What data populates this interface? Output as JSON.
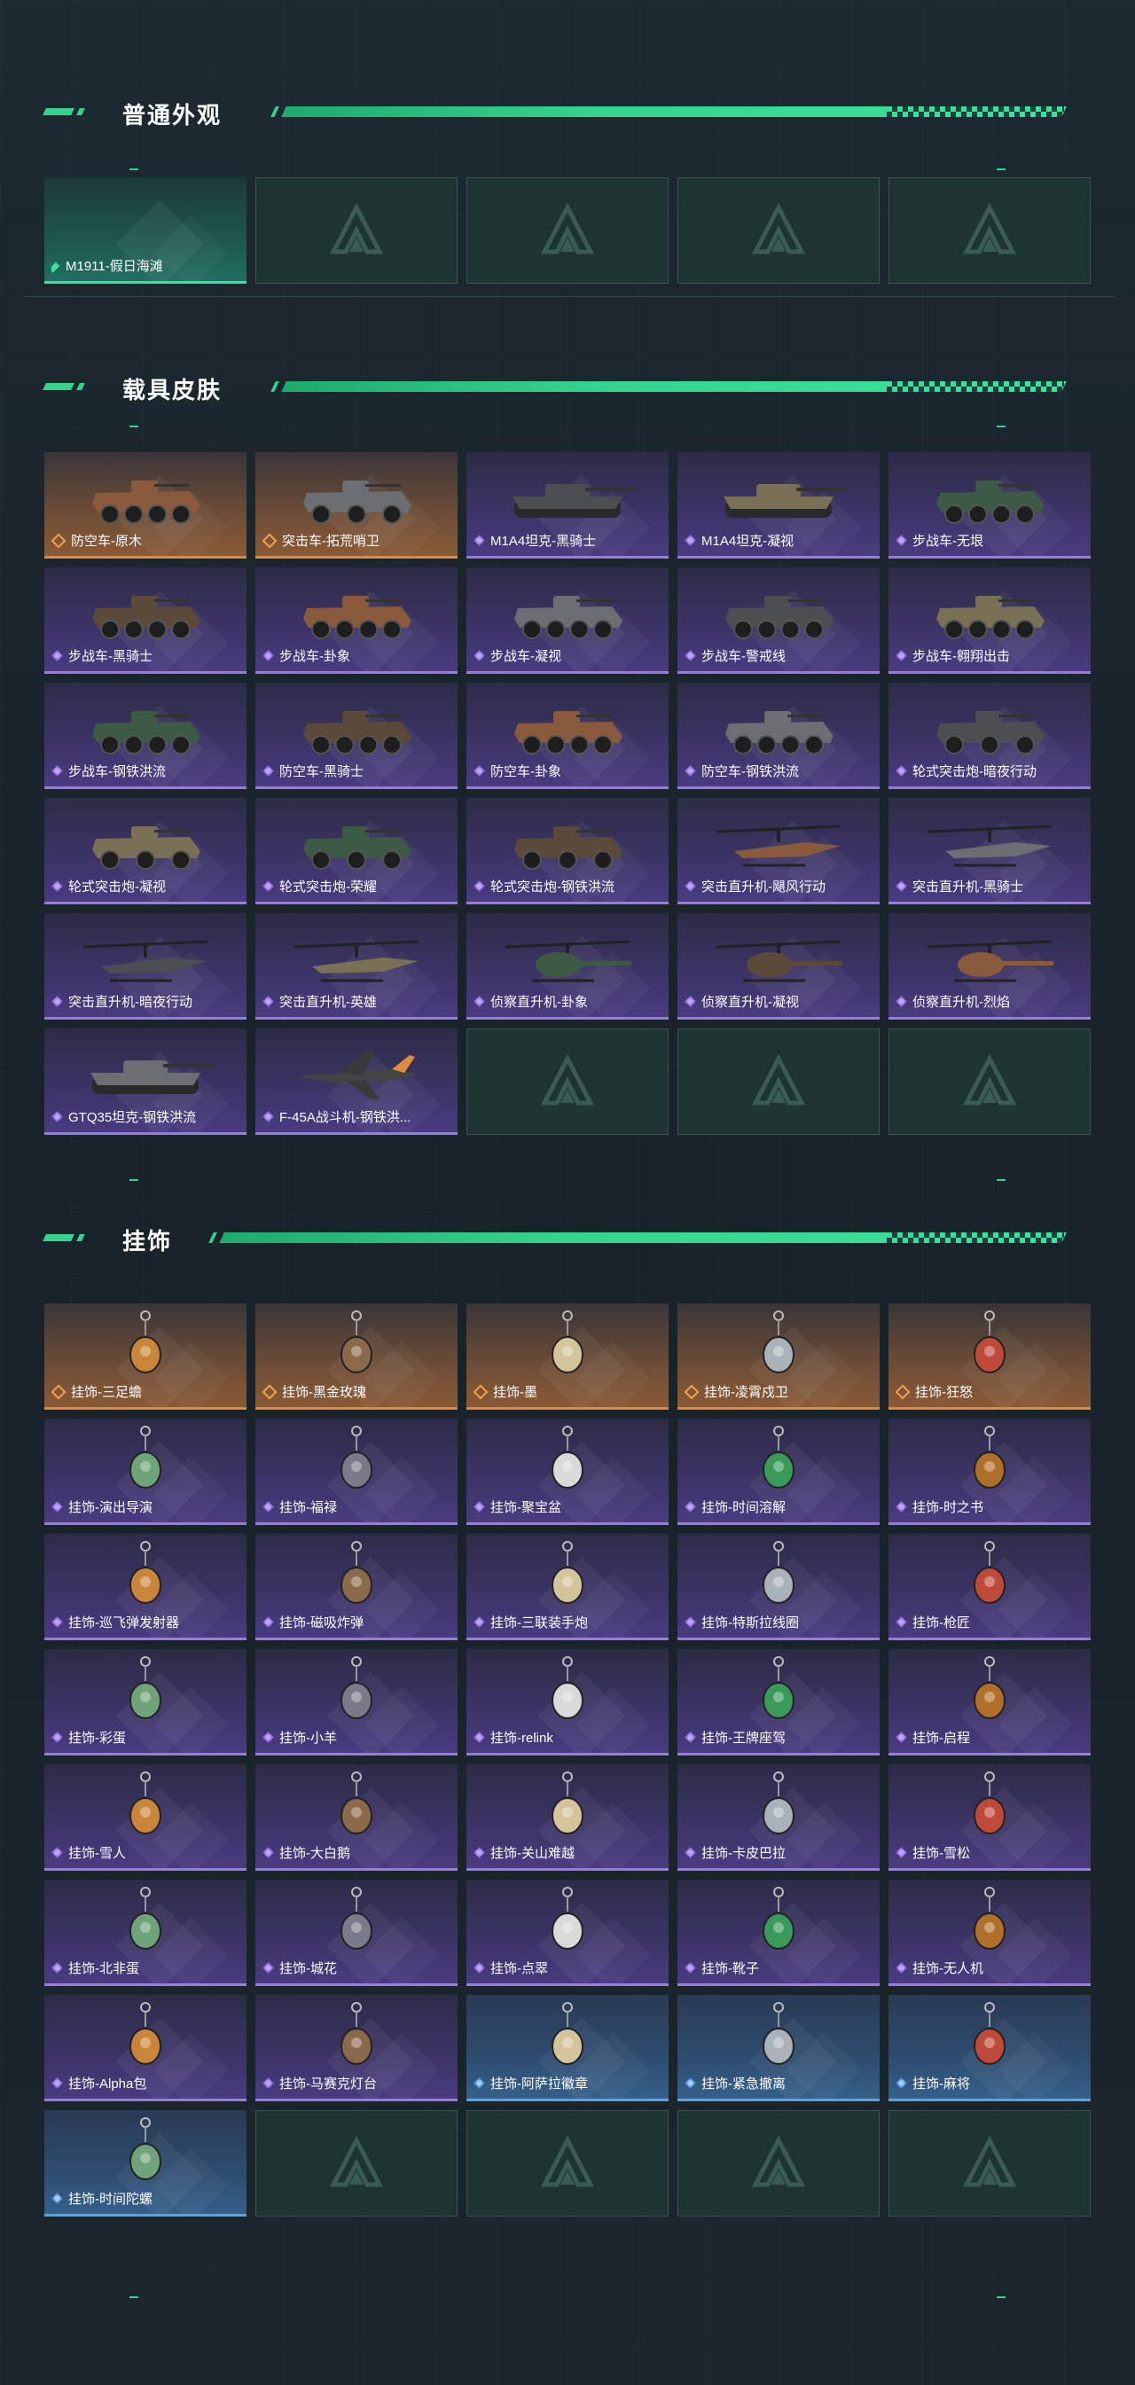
{
  "sections": {
    "appearance": {
      "title": "普通外观"
    },
    "vehicle": {
      "title": "载具皮肤"
    },
    "charm": {
      "title": "挂饰"
    }
  },
  "appearance_items": [
    {
      "label": "M1911-假日海滩",
      "rarity": "green"
    }
  ],
  "vehicle_items": [
    {
      "label": "防空车-原木",
      "rarity": "orange",
      "icon": "wheeled-apc-icon"
    },
    {
      "label": "突击车-拓荒哨卫",
      "rarity": "orange",
      "icon": "armored-car-icon"
    },
    {
      "label": "M1A4坦克-黑骑士",
      "rarity": "purple",
      "icon": "tank-icon"
    },
    {
      "label": "M1A4坦克-凝视",
      "rarity": "purple",
      "icon": "tank-icon"
    },
    {
      "label": "步战车-无垠",
      "rarity": "purple",
      "icon": "ifv-icon"
    },
    {
      "label": "步战车-黑骑士",
      "rarity": "purple",
      "icon": "ifv-icon"
    },
    {
      "label": "步战车-卦象",
      "rarity": "purple",
      "icon": "ifv-icon"
    },
    {
      "label": "步战车-凝视",
      "rarity": "purple",
      "icon": "ifv-icon"
    },
    {
      "label": "步战车-警戒线",
      "rarity": "purple",
      "icon": "ifv-icon"
    },
    {
      "label": "步战车-翱翔出击",
      "rarity": "purple",
      "icon": "ifv-icon"
    },
    {
      "label": "步战车-钢铁洪流",
      "rarity": "purple",
      "icon": "ifv-icon"
    },
    {
      "label": "防空车-黑骑士",
      "rarity": "purple",
      "icon": "wheeled-apc-icon"
    },
    {
      "label": "防空车-卦象",
      "rarity": "purple",
      "icon": "wheeled-apc-icon"
    },
    {
      "label": "防空车-钢铁洪流",
      "rarity": "purple",
      "icon": "wheeled-apc-icon"
    },
    {
      "label": "轮式突击炮-暗夜行动",
      "rarity": "purple",
      "icon": "armored-car-icon"
    },
    {
      "label": "轮式突击炮-凝视",
      "rarity": "purple",
      "icon": "armored-car-icon"
    },
    {
      "label": "轮式突击炮-荣耀",
      "rarity": "purple",
      "icon": "armored-car-icon"
    },
    {
      "label": "轮式突击炮-钢铁洪流",
      "rarity": "purple",
      "icon": "armored-car-icon"
    },
    {
      "label": "突击直升机-飓风行动",
      "rarity": "purple",
      "icon": "attack-helicopter-icon"
    },
    {
      "label": "突击直升机-黑骑士",
      "rarity": "purple",
      "icon": "attack-helicopter-icon"
    },
    {
      "label": "突击直升机-暗夜行动",
      "rarity": "purple",
      "icon": "attack-helicopter-icon"
    },
    {
      "label": "突击直升机-英雄",
      "rarity": "purple",
      "icon": "attack-helicopter-icon"
    },
    {
      "label": "侦察直升机-卦象",
      "rarity": "purple",
      "icon": "scout-helicopter-icon"
    },
    {
      "label": "侦察直升机-凝视",
      "rarity": "purple",
      "icon": "scout-helicopter-icon"
    },
    {
      "label": "侦察直升机-烈焰",
      "rarity": "purple",
      "icon": "scout-helicopter-icon"
    },
    {
      "label": "GTQ35坦克-钢铁洪流",
      "rarity": "purple",
      "icon": "tank-icon"
    },
    {
      "label": "F-45A战斗机-钢铁洪...",
      "rarity": "purple",
      "icon": "fighter-jet-icon"
    }
  ],
  "charm_items": [
    {
      "label": "挂饰-三足蟾",
      "rarity": "orange"
    },
    {
      "label": "挂饰-黑金玫瑰",
      "rarity": "orange"
    },
    {
      "label": "挂饰-墨",
      "rarity": "orange"
    },
    {
      "label": "挂饰-凌霄戍卫",
      "rarity": "orange"
    },
    {
      "label": "挂饰-狂怒",
      "rarity": "orange"
    },
    {
      "label": "挂饰-演出导演",
      "rarity": "purple"
    },
    {
      "label": "挂饰-福禄",
      "rarity": "purple"
    },
    {
      "label": "挂饰-聚宝盆",
      "rarity": "purple"
    },
    {
      "label": "挂饰-时间溶解",
      "rarity": "purple"
    },
    {
      "label": "挂饰-时之书",
      "rarity": "purple"
    },
    {
      "label": "挂饰-巡飞弹发射器",
      "rarity": "purple"
    },
    {
      "label": "挂饰-磁吸炸弹",
      "rarity": "purple"
    },
    {
      "label": "挂饰-三联装手炮",
      "rarity": "purple"
    },
    {
      "label": "挂饰-特斯拉线圈",
      "rarity": "purple"
    },
    {
      "label": "挂饰-枪匠",
      "rarity": "purple"
    },
    {
      "label": "挂饰-彩蛋",
      "rarity": "purple"
    },
    {
      "label": "挂饰-小羊",
      "rarity": "purple"
    },
    {
      "label": "挂饰-relink",
      "rarity": "purple"
    },
    {
      "label": "挂饰-王牌座驾",
      "rarity": "purple"
    },
    {
      "label": "挂饰-启程",
      "rarity": "purple"
    },
    {
      "label": "挂饰-雪人",
      "rarity": "purple"
    },
    {
      "label": "挂饰-大白鹅",
      "rarity": "purple"
    },
    {
      "label": "挂饰-关山难越",
      "rarity": "purple"
    },
    {
      "label": "挂饰-卡皮巴拉",
      "rarity": "purple"
    },
    {
      "label": "挂饰-雪松",
      "rarity": "purple"
    },
    {
      "label": "挂饰-北非蛋",
      "rarity": "purple"
    },
    {
      "label": "挂饰-城花",
      "rarity": "purple"
    },
    {
      "label": "挂饰-点翠",
      "rarity": "purple"
    },
    {
      "label": "挂饰-靴子",
      "rarity": "purple"
    },
    {
      "label": "挂饰-无人机",
      "rarity": "purple"
    },
    {
      "label": "挂饰-Alpha包",
      "rarity": "purple"
    },
    {
      "label": "挂饰-马赛克灯台",
      "rarity": "purple"
    },
    {
      "label": "挂饰-阿萨拉徽章",
      "rarity": "blue"
    },
    {
      "label": "挂饰-紧急撤离",
      "rarity": "blue"
    },
    {
      "label": "挂饰-麻将",
      "rarity": "blue"
    },
    {
      "label": "挂饰-时间陀螺",
      "rarity": "blue"
    }
  ],
  "colors": {
    "accent": "#35d48e",
    "orange": "#e08a3a",
    "purple": "#9a7be6",
    "blue": "#5aa2e6"
  }
}
